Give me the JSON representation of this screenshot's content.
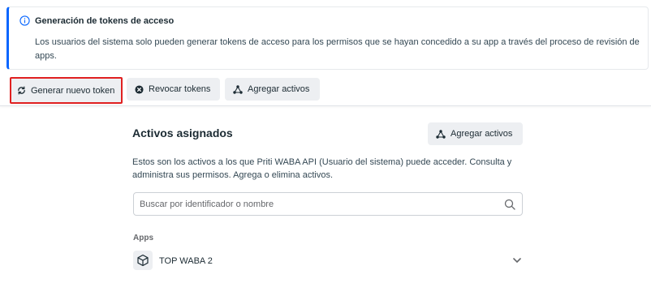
{
  "banner": {
    "title": "Generación de tokens de acceso",
    "description": "Los usuarios del sistema solo pueden generar tokens de acceso para los permisos que se hayan concedido a su app a través del proceso de revisión de apps.",
    "icon": "info-icon"
  },
  "toolbar": {
    "generate_label": "Generar nuevo token",
    "revoke_label": "Revocar tokens",
    "add_assets_label": "Agregar activos"
  },
  "assets": {
    "title": "Activos asignados",
    "add_button_label": "Agregar activos",
    "description": "Estos son los activos a los que Priti WABA API (Usuario del sistema) puede acceder. Consulta y administra sus permisos. Agrega o elimina activos.",
    "search_placeholder": "Buscar por identificador o nombre",
    "apps_label": "Apps",
    "apps": [
      {
        "name": "TOP WABA 2",
        "icon": "cube-icon"
      }
    ]
  },
  "colors": {
    "accent": "#0866ff",
    "highlight_border": "#e02020",
    "button_bg": "#edeff2"
  }
}
